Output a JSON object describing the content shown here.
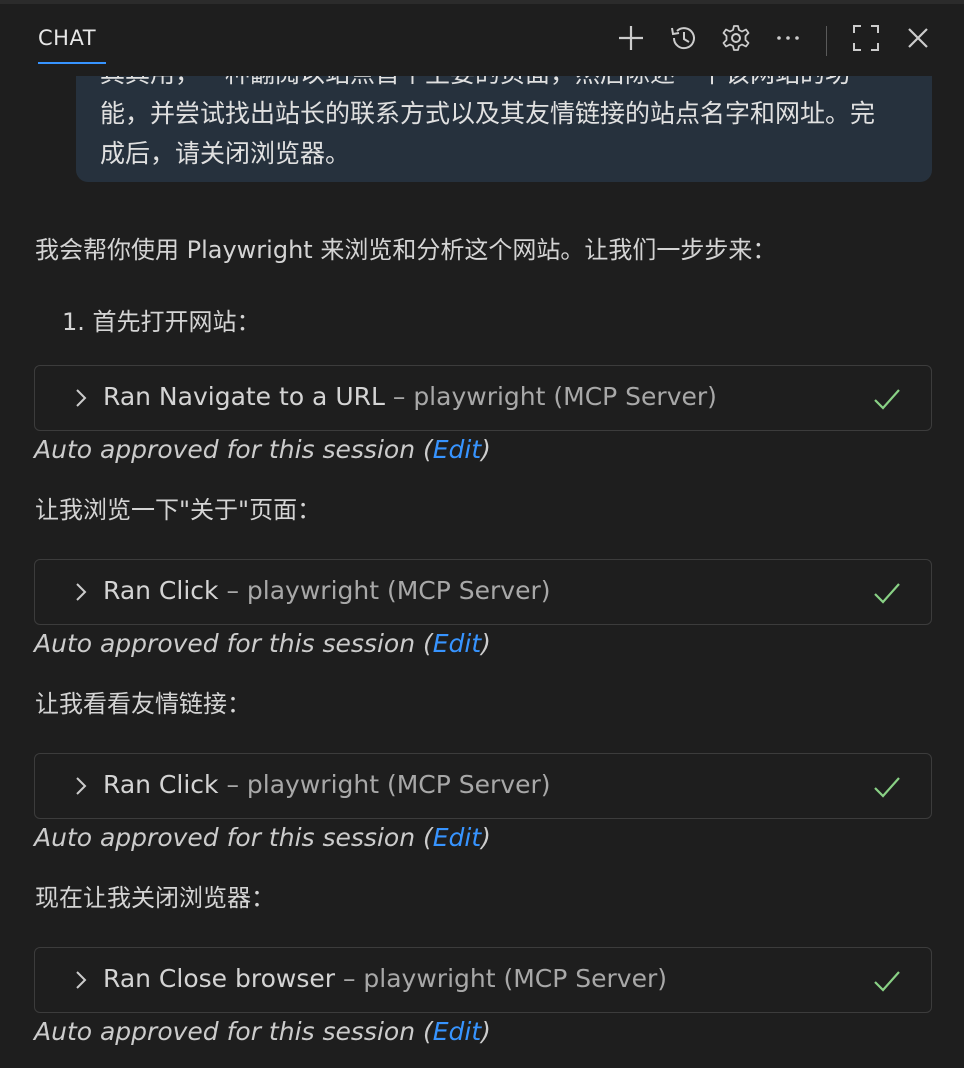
{
  "header": {
    "tab_label": "CHAT",
    "icons": [
      "plus-icon",
      "history-icon",
      "gear-icon",
      "more-icon",
      "maximize-icon",
      "close-icon"
    ]
  },
  "user_message": {
    "line1": "其其用，一种翻阅以站点首个主要的页面，然后陈述一下该网站的功",
    "line2": "能，并尝试找出站长的联系方式以及其友情链接的站点名字和网址。完",
    "line3": "成后，请关闭浏览器。"
  },
  "assistant": {
    "intro": "我会帮你使用 Playwright 来浏览和分析这个网站。让我们一步步来：",
    "step1": "1. 首先打开网站：",
    "about_text": "让我浏览一下\"关于\"页面：",
    "links_text": "让我看看友情链接：",
    "close_text": "现在让我关闭浏览器：",
    "tools": [
      {
        "action": "Ran Navigate to a URL",
        "source": " – playwright (MCP Server)"
      },
      {
        "action": "Ran Click",
        "source": " – playwright (MCP Server)"
      },
      {
        "action": "Ran Click",
        "source": " – playwright (MCP Server)"
      },
      {
        "action": "Ran Close browser",
        "source": " – playwright (MCP Server)"
      }
    ],
    "approved": {
      "prefix": "Auto approved for this session (",
      "link": "Edit",
      "suffix": ")"
    }
  },
  "colors": {
    "background": "#1e1e1e",
    "accent": "#3794ff",
    "check": "#89d185",
    "user_bubble": "#26313d"
  }
}
